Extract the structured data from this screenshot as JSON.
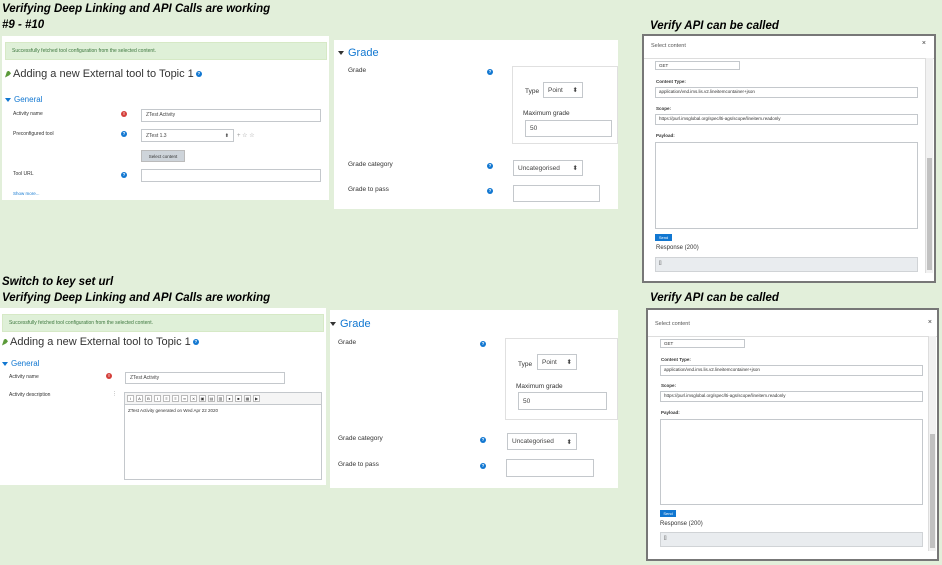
{
  "headings": {
    "top_title": "Verifying Deep Linking and API Calls are working",
    "top_subtitle": "#9 - #10",
    "top_verify": "Verify API can be called",
    "switch": "Switch to key set url",
    "bottom_title": "Verifying Deep Linking and API Calls are working",
    "bottom_verify": "Verify API can be called"
  },
  "top_form": {
    "alert": "Successfully fetched tool configuration from the selected content.",
    "page_title": "Adding a new External tool to Topic 1",
    "section": "General",
    "activity_name_label": "Activity name",
    "activity_name_value": "ZTest Activity",
    "preconfigured_label": "Preconfigured tool",
    "preconfigured_value": "ZTest 1.3",
    "select_content_button": "Select content",
    "tool_url_label": "Tool URL",
    "show_more": "Show more..."
  },
  "top_grade": {
    "section": "Grade",
    "grade_label": "Grade",
    "type_label": "Type",
    "type_value": "Point",
    "max_grade_label": "Maximum grade",
    "max_grade_value": "50",
    "category_label": "Grade category",
    "category_value": "Uncategorised",
    "pass_label": "Grade to pass"
  },
  "top_modal": {
    "title": "Select content",
    "close": "×",
    "method_value": "GET",
    "content_type_label": "Content Type:",
    "content_type_value": "application/vnd.ims.lis.v2.lineitemcontainer+json",
    "scope_label": "Scope:",
    "scope_value": "https://purl.imsglobal.org/spec/lti-ags/scope/lineitem.readonly",
    "payload_label": "Payload:",
    "send_button": "Send",
    "response_label": "Response (200)",
    "response_value": "[]"
  },
  "bottom_form": {
    "alert": "Successfully fetched tool configuration from the selected content.",
    "page_title": "Adding a new External tool to Topic 1",
    "section": "General",
    "activity_name_label": "Activity name",
    "activity_name_value": "ZTest Activity",
    "activity_desc_label": "Activity description",
    "editor_text": "ZTest Activity generated on Wed Apr 22 2020"
  },
  "bottom_grade": {
    "section": "Grade",
    "grade_label": "Grade",
    "type_label": "Type",
    "type_value": "Point",
    "max_grade_label": "Maximum grade",
    "max_grade_value": "50",
    "category_label": "Grade category",
    "category_value": "Uncategorised",
    "pass_label": "Grade to pass"
  },
  "bottom_modal": {
    "title": "Select content",
    "close": "×",
    "method_value": "GET",
    "content_type_label": "Content Type:",
    "content_type_value": "application/vnd.ims.lis.v2.lineitemcontainer+json",
    "scope_label": "Scope:",
    "scope_value": "https://purl.imsglobal.org/spec/lti-ags/scope/lineitem.readonly",
    "payload_label": "Payload:",
    "send_button": "Send",
    "response_label": "Response (200)",
    "response_value": "[]"
  },
  "icons": {
    "help": "?",
    "required": "!",
    "select_arrow": "⬍"
  },
  "colors": {
    "background": "#e2efda",
    "accent": "#1177d1",
    "alert_bg": "#dff0d8"
  }
}
